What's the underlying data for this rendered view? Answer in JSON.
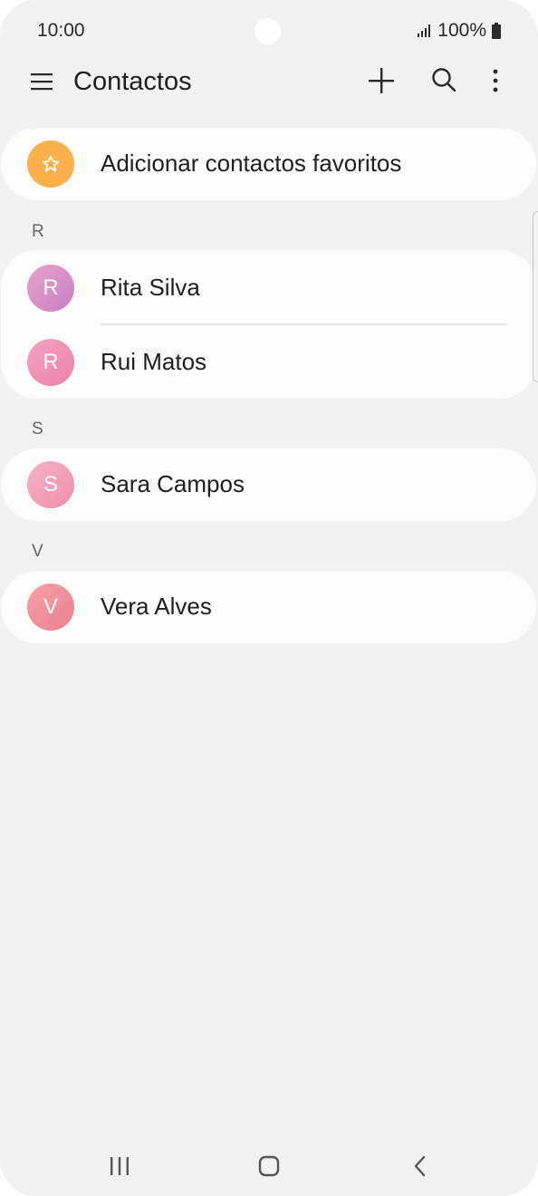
{
  "status_bar": {
    "time": "10:00",
    "battery": "100%",
    "icons": [
      "signal-icon",
      "battery-icon"
    ]
  },
  "app_bar": {
    "title": "Contactos",
    "icons": [
      "menu-icon",
      "add-icon",
      "search-icon",
      "more-icon"
    ]
  },
  "favorites": {
    "label": "Adicionar contactos favoritos",
    "icon": "star-icon",
    "color": "#fbb04b"
  },
  "sections": [
    {
      "header": "R",
      "contacts": [
        {
          "initial": "R",
          "name": "Rita Silva",
          "color": "#d98ac6"
        },
        {
          "initial": "R",
          "name": "Rui Matos",
          "color": "#f08fb2"
        }
      ]
    },
    {
      "header": "S",
      "contacts": [
        {
          "initial": "S",
          "name": "Sara Campos",
          "color": "#f29cb6"
        }
      ]
    },
    {
      "header": "V",
      "contacts": [
        {
          "initial": "V",
          "name": "Vera Alves",
          "color": "#f08a92"
        }
      ]
    }
  ],
  "nav_bar": {
    "icons": [
      "recent-apps-icon",
      "home-icon",
      "back-icon"
    ]
  }
}
